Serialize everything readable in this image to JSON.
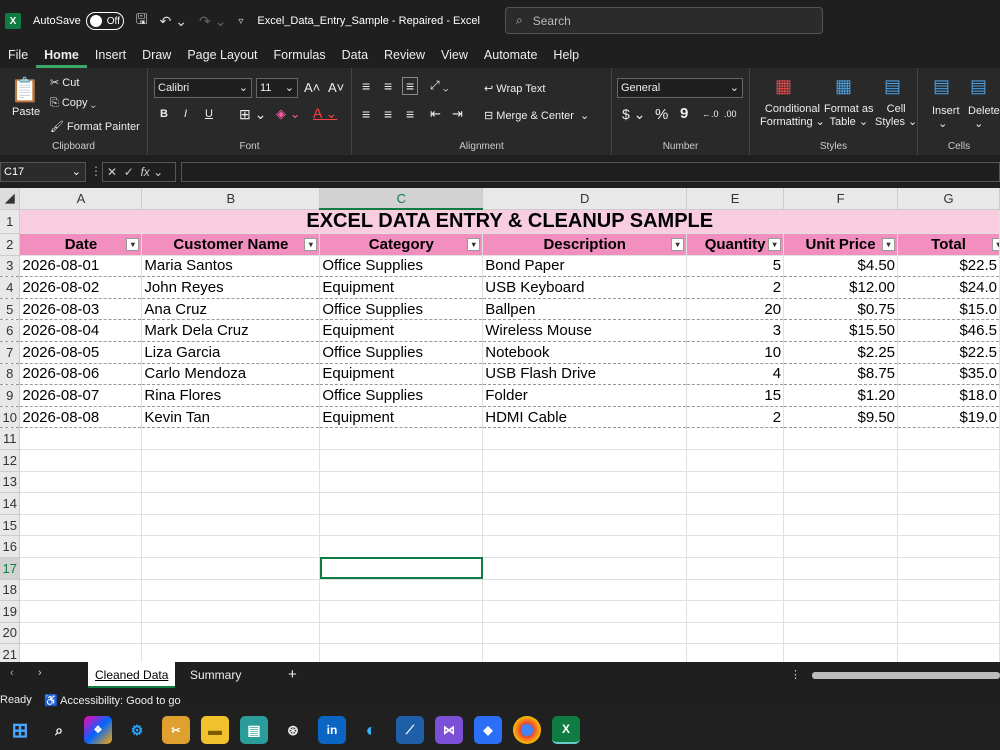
{
  "titlebar": {
    "autosave_label": "AutoSave",
    "autosave_state": "Off",
    "document_title": "Excel_Data_Entry_Sample  -  Repaired  -  Excel",
    "search_placeholder": "Search"
  },
  "menu": [
    "File",
    "Home",
    "Insert",
    "Draw",
    "Page Layout",
    "Formulas",
    "Data",
    "Review",
    "View",
    "Automate",
    "Help"
  ],
  "ribbon": {
    "clipboard": {
      "paste": "Paste",
      "cut": "Cut",
      "copy": "Copy",
      "format_painter": "Format Painter",
      "label": "Clipboard"
    },
    "font": {
      "name": "Calibri",
      "size": "11",
      "label": "Font",
      "bold": "B",
      "italic": "I",
      "underline": "U"
    },
    "alignment": {
      "wrap": "Wrap Text",
      "merge": "Merge & Center",
      "label": "Alignment"
    },
    "number": {
      "format": "General",
      "currency": "$",
      "percent": "%",
      "comma": "9",
      "label": "Number"
    },
    "styles": {
      "conditional": "Conditional",
      "conditional2": "Formatting",
      "format_table": "Format as",
      "format_table2": "Table",
      "cell_styles": "Cell",
      "cell_styles2": "Styles",
      "label": "Styles"
    },
    "cells": {
      "insert": "Insert",
      "delete": "Delete",
      "label": "Cells"
    }
  },
  "formula_bar": {
    "name_box": "C17",
    "fx": "fx",
    "value": ""
  },
  "sheet": {
    "columns": [
      "A",
      "B",
      "C",
      "D",
      "E",
      "F",
      "G"
    ],
    "title": "EXCEL DATA ENTRY & CLEANUP SAMPLE",
    "headers": [
      "Date",
      "Customer Name",
      "Category",
      "Description",
      "Quantity",
      "Unit Price",
      "Total"
    ],
    "rows": [
      [
        "2026-08-01",
        "Maria Santos",
        "Office Supplies",
        "Bond Paper",
        "5",
        "$4.50",
        "$22.5"
      ],
      [
        "2026-08-02",
        "John Reyes",
        "Equipment",
        "USB Keyboard",
        "2",
        "$12.00",
        "$24.0"
      ],
      [
        "2026-08-03",
        "Ana Cruz",
        "Office Supplies",
        "Ballpen",
        "20",
        "$0.75",
        "$15.0"
      ],
      [
        "2026-08-04",
        "Mark Dela Cruz",
        "Equipment",
        "Wireless Mouse",
        "3",
        "$15.50",
        "$46.5"
      ],
      [
        "2026-08-05",
        "Liza Garcia",
        "Office Supplies",
        "Notebook",
        "10",
        "$2.25",
        "$22.5"
      ],
      [
        "2026-08-06",
        "Carlo Mendoza",
        "Equipment",
        "USB Flash Drive",
        "4",
        "$8.75",
        "$35.0"
      ],
      [
        "2026-08-07",
        "Rina Flores",
        "Office Supplies",
        "Folder",
        "15",
        "$1.20",
        "$18.0"
      ],
      [
        "2026-08-08",
        "Kevin Tan",
        "Equipment",
        "HDMI Cable",
        "2",
        "$9.50",
        "$19.0"
      ]
    ],
    "row_numbers": [
      "1",
      "2",
      "3",
      "4",
      "5",
      "6",
      "7",
      "8",
      "9",
      "10",
      "11",
      "12",
      "13",
      "14",
      "15",
      "16",
      "17",
      "18",
      "19",
      "20",
      "21"
    ],
    "selected_row": "17"
  },
  "tabs": {
    "active": "Cleaned Data",
    "other": "Summary",
    "add": "+"
  },
  "status": {
    "ready": "Ready",
    "accessibility": "Accessibility: Good to go"
  }
}
